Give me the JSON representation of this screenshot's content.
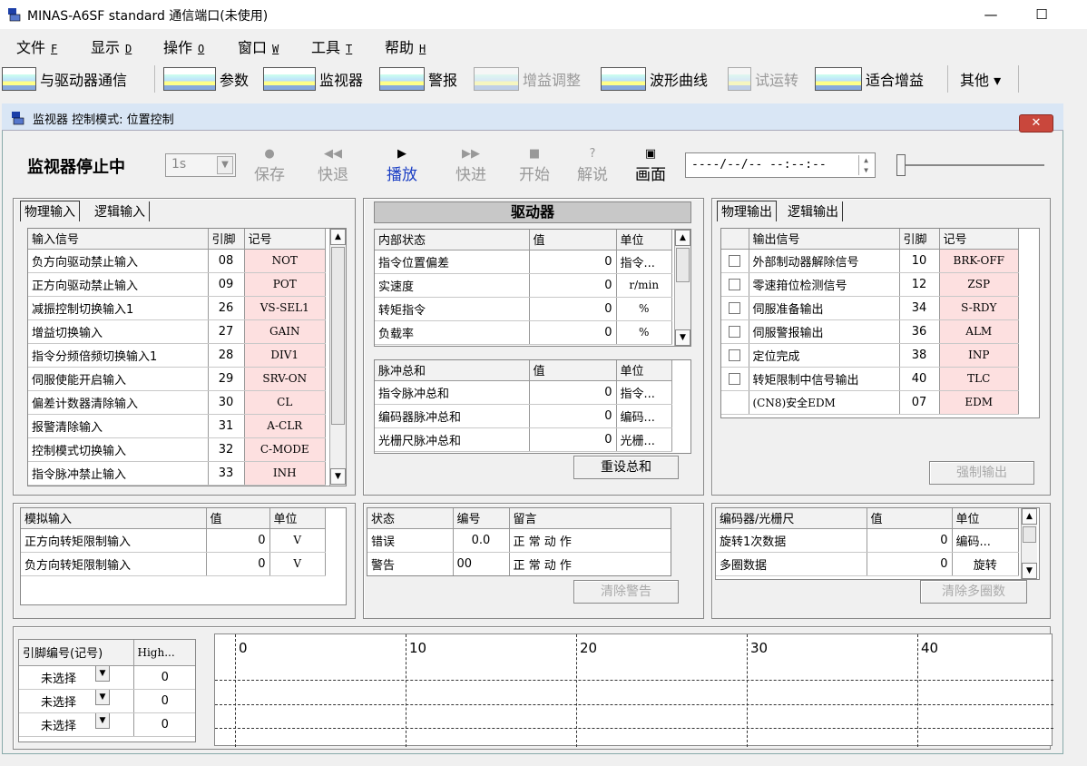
{
  "window": {
    "title": "MINAS-A6SF standard  通信端口(未使用)",
    "minimize": "—",
    "maximize": "☐"
  },
  "menu": [
    {
      "label": "文件",
      "key": "F"
    },
    {
      "label": "显示",
      "key": "D"
    },
    {
      "label": "操作",
      "key": "O"
    },
    {
      "label": "窗口",
      "key": "W"
    },
    {
      "label": "工具",
      "key": "T"
    },
    {
      "label": "帮助",
      "key": "H"
    }
  ],
  "toolbar": {
    "comm": "与驱动器通信",
    "params": "参数",
    "monitor": "监视器",
    "alarm": "警报",
    "gain": "增益调整",
    "wave": "波形曲线",
    "trial": "试运转",
    "fitgain": "适合增益",
    "other": "其他 ▾"
  },
  "subwindow": {
    "title": "监视器   控制模式: 位置控制",
    "close": "✕"
  },
  "controls": {
    "status": "监视器停止中",
    "rate": "1s",
    "save": "保存",
    "rewind": "快退",
    "play": "播放",
    "forward": "快进",
    "start": "开始",
    "explain": "解说",
    "screen": "画面",
    "datetime": "----/--/-- --:--:--"
  },
  "input_panel": {
    "tabs": [
      "物理输入",
      "逻辑输入"
    ],
    "headers": [
      "输入信号",
      "引脚",
      "记号"
    ],
    "rows": [
      {
        "signal": "负方向驱动禁止输入",
        "pin": "08",
        "sym": "NOT"
      },
      {
        "signal": "正方向驱动禁止输入",
        "pin": "09",
        "sym": "POT"
      },
      {
        "signal": "减振控制切换输入1",
        "pin": "26",
        "sym": "VS-SEL1"
      },
      {
        "signal": "增益切换输入",
        "pin": "27",
        "sym": "GAIN"
      },
      {
        "signal": "指令分频倍频切换输入1",
        "pin": "28",
        "sym": "DIV1"
      },
      {
        "signal": "伺服使能开启输入",
        "pin": "29",
        "sym": "SRV-ON"
      },
      {
        "signal": "偏差计数器清除输入",
        "pin": "30",
        "sym": "CL"
      },
      {
        "signal": "报警清除输入",
        "pin": "31",
        "sym": "A-CLR"
      },
      {
        "signal": "控制模式切换输入",
        "pin": "32",
        "sym": "C-MODE"
      },
      {
        "signal": "指令脉冲禁止输入",
        "pin": "33",
        "sym": "INH"
      }
    ]
  },
  "driver_panel": {
    "header": "驱动器",
    "internal": {
      "headers": [
        "内部状态",
        "值",
        "单位"
      ],
      "rows": [
        {
          "name": "指令位置偏差",
          "val": "0",
          "unit": "指令..."
        },
        {
          "name": "实速度",
          "val": "0",
          "unit": "r/min"
        },
        {
          "name": "转矩指令",
          "val": "0",
          "unit": "%"
        },
        {
          "name": "负载率",
          "val": "0",
          "unit": "%"
        }
      ]
    },
    "pulse": {
      "headers": [
        "脉冲总和",
        "值",
        "单位"
      ],
      "rows": [
        {
          "name": "指令脉冲总和",
          "val": "0",
          "unit": "指令..."
        },
        {
          "name": "编码器脉冲总和",
          "val": "0",
          "unit": "编码..."
        },
        {
          "name": "光栅尺脉冲总和",
          "val": "0",
          "unit": "光栅..."
        }
      ]
    },
    "reset": "重设总和"
  },
  "output_panel": {
    "tabs": [
      "物理输出",
      "逻辑输出"
    ],
    "headers": [
      "输出信号",
      "引脚",
      "记号"
    ],
    "rows": [
      {
        "signal": "外部制动器解除信号",
        "pin": "10",
        "sym": "BRK-OFF"
      },
      {
        "signal": "零速箝位检测信号",
        "pin": "12",
        "sym": "ZSP"
      },
      {
        "signal": "伺服准备输出",
        "pin": "34",
        "sym": "S-RDY"
      },
      {
        "signal": "伺服警报输出",
        "pin": "36",
        "sym": "ALM"
      },
      {
        "signal": "定位完成",
        "pin": "38",
        "sym": "INP"
      },
      {
        "signal": "转矩限制中信号输出",
        "pin": "40",
        "sym": "TLC"
      },
      {
        "signal": "(CN8)安全EDM",
        "pin": "07",
        "sym": "EDM"
      }
    ],
    "force": "强制输出"
  },
  "analog_panel": {
    "headers": [
      "模拟输入",
      "值",
      "单位"
    ],
    "rows": [
      {
        "name": "正方向转矩限制输入",
        "val": "0",
        "unit": "V"
      },
      {
        "name": "负方向转矩限制输入",
        "val": "0",
        "unit": "V"
      }
    ]
  },
  "status_panel": {
    "headers": [
      "状态",
      "编号",
      "留言"
    ],
    "rows": [
      {
        "name": "错误",
        "code": "0.0",
        "msg": "正 常 动 作"
      },
      {
        "name": "警告",
        "code": "00",
        "msg": "正 常 动 作"
      }
    ],
    "clear": "清除警告"
  },
  "encoder_panel": {
    "headers": [
      "编码器/光栅尺",
      "值",
      "单位"
    ],
    "rows": [
      {
        "name": "旋转1次数据",
        "val": "0",
        "unit": "编码..."
      },
      {
        "name": "多圈数据",
        "val": "0",
        "unit": "旋转"
      }
    ],
    "clear": "清除多圈数"
  },
  "pin_panel": {
    "headers": [
      "引脚编号(记号)",
      "High..."
    ],
    "rows": [
      {
        "sel": "未选择",
        "val": "0"
      },
      {
        "sel": "未选择",
        "val": "0"
      },
      {
        "sel": "未选择",
        "val": "0"
      }
    ]
  },
  "wave": {
    "ticks": [
      "0",
      "10",
      "20",
      "30",
      "40"
    ]
  }
}
